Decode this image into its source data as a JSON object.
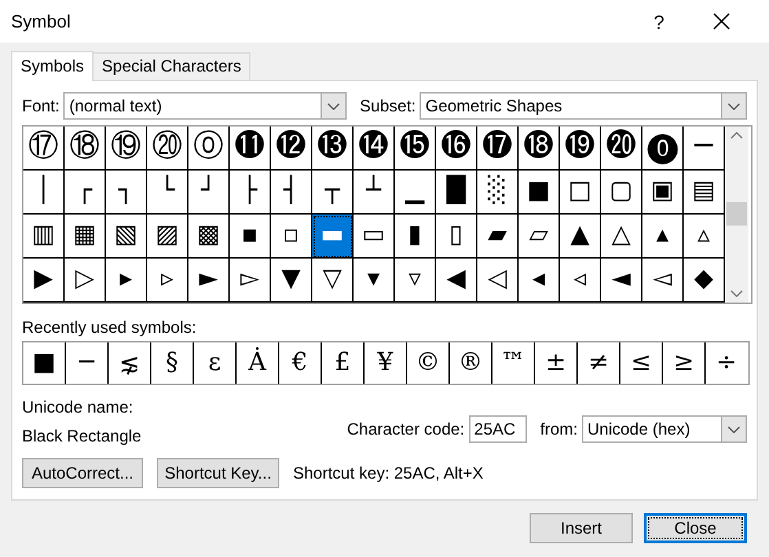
{
  "window": {
    "title": "Symbol",
    "help": "?"
  },
  "tabs": [
    {
      "label": "Symbols",
      "selected": true
    },
    {
      "label": "Special Characters",
      "selected": false
    }
  ],
  "font": {
    "label": "Font:",
    "value": "(normal text)"
  },
  "subset": {
    "label": "Subset:",
    "value": "Geometric Shapes"
  },
  "grid": {
    "rows": [
      [
        {
          "char": "⑰",
          "selected": false
        },
        {
          "char": "⑱",
          "selected": false
        },
        {
          "char": "⑲",
          "selected": false
        },
        {
          "char": "⑳",
          "selected": false
        },
        {
          "char": "⓪",
          "selected": false
        },
        {
          "char": "⓫",
          "selected": false
        },
        {
          "char": "⓬",
          "selected": false
        },
        {
          "char": "⓭",
          "selected": false
        },
        {
          "char": "⓮",
          "selected": false
        },
        {
          "char": "⓯",
          "selected": false
        },
        {
          "char": "⓰",
          "selected": false
        },
        {
          "char": "⓱",
          "selected": false
        },
        {
          "char": "⓲",
          "selected": false
        },
        {
          "char": "⓳",
          "selected": false
        },
        {
          "char": "⓴",
          "selected": false
        },
        {
          "char": "⓿",
          "selected": false
        },
        {
          "char": "─",
          "selected": false
        }
      ],
      [
        {
          "char": "│",
          "selected": false
        },
        {
          "char": "┌",
          "selected": false
        },
        {
          "char": "┐",
          "selected": false
        },
        {
          "char": "└",
          "selected": false
        },
        {
          "char": "┘",
          "selected": false
        },
        {
          "char": "├",
          "selected": false
        },
        {
          "char": "┤",
          "selected": false
        },
        {
          "char": "┬",
          "selected": false
        },
        {
          "char": "┴",
          "selected": false
        },
        {
          "char": "▁",
          "selected": false
        },
        {
          "char": "█",
          "selected": false
        },
        {
          "char": "░",
          "selected": false
        },
        {
          "char": "■",
          "selected": false
        },
        {
          "char": "□",
          "selected": false
        },
        {
          "char": "▢",
          "selected": false
        },
        {
          "char": "▣",
          "selected": false
        },
        {
          "char": "▤",
          "selected": false
        }
      ],
      [
        {
          "char": "▥",
          "selected": false
        },
        {
          "char": "▦",
          "selected": false
        },
        {
          "char": "▧",
          "selected": false
        },
        {
          "char": "▨",
          "selected": false
        },
        {
          "char": "▩",
          "selected": false
        },
        {
          "char": "▪",
          "selected": false
        },
        {
          "char": "▫",
          "selected": false
        },
        {
          "char": "▬",
          "selected": true
        },
        {
          "char": "▭",
          "selected": false
        },
        {
          "char": "▮",
          "selected": false
        },
        {
          "char": "▯",
          "selected": false
        },
        {
          "char": "▰",
          "selected": false
        },
        {
          "char": "▱",
          "selected": false
        },
        {
          "char": "▲",
          "selected": false
        },
        {
          "char": "△",
          "selected": false
        },
        {
          "char": "▴",
          "selected": false
        },
        {
          "char": "▵",
          "selected": false
        }
      ],
      [
        {
          "char": "▶",
          "selected": false
        },
        {
          "char": "▷",
          "selected": false
        },
        {
          "char": "▸",
          "selected": false
        },
        {
          "char": "▹",
          "selected": false
        },
        {
          "char": "►",
          "selected": false
        },
        {
          "char": "▻",
          "selected": false
        },
        {
          "char": "▼",
          "selected": false
        },
        {
          "char": "▽",
          "selected": false
        },
        {
          "char": "▾",
          "selected": false
        },
        {
          "char": "▿",
          "selected": false
        },
        {
          "char": "◀",
          "selected": false
        },
        {
          "char": "◁",
          "selected": false
        },
        {
          "char": "◂",
          "selected": false
        },
        {
          "char": "◃",
          "selected": false
        },
        {
          "char": "◄",
          "selected": false
        },
        {
          "char": "◅",
          "selected": false
        },
        {
          "char": "◆",
          "selected": false
        }
      ]
    ]
  },
  "recent": {
    "label": "Recently used symbols:",
    "symbols": [
      "■",
      "─",
      "⋦",
      "§",
      "ε",
      "Ȧ",
      "€",
      "£",
      "¥",
      "©",
      "®",
      "™",
      "±",
      "≠",
      "≤",
      "≥",
      "÷"
    ]
  },
  "unicode_name": {
    "label": "Unicode name:",
    "value": "Black Rectangle"
  },
  "character_code": {
    "label": "Character code:",
    "value": "25AC"
  },
  "from": {
    "label": "from:",
    "value": "Unicode (hex)"
  },
  "autocorrect_button": "AutoCorrect...",
  "shortcut_key_button": "Shortcut Key...",
  "shortcut_key_text": "Shortcut key: 25AC, Alt+X",
  "footer_buttons": [
    {
      "label": "Insert",
      "focused": false
    },
    {
      "label": "Close",
      "focused": true
    }
  ]
}
